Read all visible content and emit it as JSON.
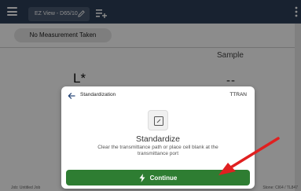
{
  "app": {
    "tab_label": "EZ View - D65/10",
    "icons": {
      "menu": "hamburger-menu-icon",
      "edit": "pencil-icon",
      "add_tab": "add-tab-icon"
    },
    "colors": {
      "topbar": "#2c3e58",
      "tab_pill": "#4a5a72"
    }
  },
  "background": {
    "status_pill": "No Measurement Taken",
    "sample_header": "Sample",
    "lstar_label": "L*",
    "sample_value": "--",
    "bottom_left": "Job: Untitled Job",
    "bottom_right": "Stone: CI64 / TL847"
  },
  "dialog": {
    "title": "Standardization",
    "mode": "TTRAN",
    "heading": "Standardize",
    "description": "Clear the transmittance path or place cell blank at the transmittance port",
    "continue_label": "Continue",
    "icons": {
      "back": "back-arrow-icon",
      "step": "transmittance-port-icon",
      "continue": "lightning-bolt-icon"
    },
    "colors": {
      "continue_button": "#2e7d32"
    }
  },
  "annotation": {
    "arrow_color": "#e02020"
  }
}
